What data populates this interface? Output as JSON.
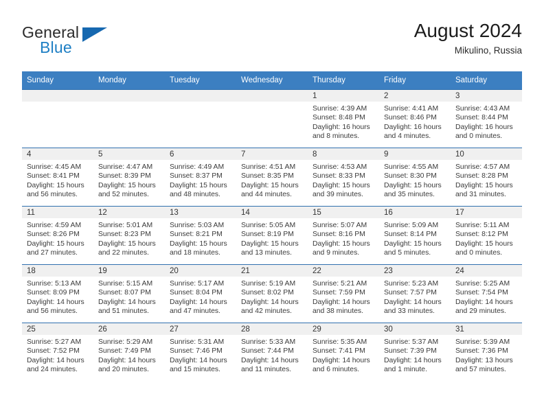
{
  "brand": {
    "line1": "General",
    "line2": "Blue",
    "triangle_icon": "triangle-logo-icon",
    "blue": "#1e7fc4"
  },
  "header": {
    "title": "August 2024",
    "subtitle": "Mikulino, Russia"
  },
  "calendar": {
    "header_bg": "#3C7FC1",
    "daynum_bg": "#f0f0f0",
    "weekdays": [
      "Sunday",
      "Monday",
      "Tuesday",
      "Wednesday",
      "Thursday",
      "Friday",
      "Saturday"
    ],
    "weeks": [
      [
        {
          "day": "",
          "sunrise": "",
          "sunset": "",
          "daylight1": "",
          "daylight2": ""
        },
        {
          "day": "",
          "sunrise": "",
          "sunset": "",
          "daylight1": "",
          "daylight2": ""
        },
        {
          "day": "",
          "sunrise": "",
          "sunset": "",
          "daylight1": "",
          "daylight2": ""
        },
        {
          "day": "",
          "sunrise": "",
          "sunset": "",
          "daylight1": "",
          "daylight2": ""
        },
        {
          "day": "1",
          "sunrise": "Sunrise: 4:39 AM",
          "sunset": "Sunset: 8:48 PM",
          "daylight1": "Daylight: 16 hours",
          "daylight2": "and 8 minutes."
        },
        {
          "day": "2",
          "sunrise": "Sunrise: 4:41 AM",
          "sunset": "Sunset: 8:46 PM",
          "daylight1": "Daylight: 16 hours",
          "daylight2": "and 4 minutes."
        },
        {
          "day": "3",
          "sunrise": "Sunrise: 4:43 AM",
          "sunset": "Sunset: 8:44 PM",
          "daylight1": "Daylight: 16 hours",
          "daylight2": "and 0 minutes."
        }
      ],
      [
        {
          "day": "4",
          "sunrise": "Sunrise: 4:45 AM",
          "sunset": "Sunset: 8:41 PM",
          "daylight1": "Daylight: 15 hours",
          "daylight2": "and 56 minutes."
        },
        {
          "day": "5",
          "sunrise": "Sunrise: 4:47 AM",
          "sunset": "Sunset: 8:39 PM",
          "daylight1": "Daylight: 15 hours",
          "daylight2": "and 52 minutes."
        },
        {
          "day": "6",
          "sunrise": "Sunrise: 4:49 AM",
          "sunset": "Sunset: 8:37 PM",
          "daylight1": "Daylight: 15 hours",
          "daylight2": "and 48 minutes."
        },
        {
          "day": "7",
          "sunrise": "Sunrise: 4:51 AM",
          "sunset": "Sunset: 8:35 PM",
          "daylight1": "Daylight: 15 hours",
          "daylight2": "and 44 minutes."
        },
        {
          "day": "8",
          "sunrise": "Sunrise: 4:53 AM",
          "sunset": "Sunset: 8:33 PM",
          "daylight1": "Daylight: 15 hours",
          "daylight2": "and 39 minutes."
        },
        {
          "day": "9",
          "sunrise": "Sunrise: 4:55 AM",
          "sunset": "Sunset: 8:30 PM",
          "daylight1": "Daylight: 15 hours",
          "daylight2": "and 35 minutes."
        },
        {
          "day": "10",
          "sunrise": "Sunrise: 4:57 AM",
          "sunset": "Sunset: 8:28 PM",
          "daylight1": "Daylight: 15 hours",
          "daylight2": "and 31 minutes."
        }
      ],
      [
        {
          "day": "11",
          "sunrise": "Sunrise: 4:59 AM",
          "sunset": "Sunset: 8:26 PM",
          "daylight1": "Daylight: 15 hours",
          "daylight2": "and 27 minutes."
        },
        {
          "day": "12",
          "sunrise": "Sunrise: 5:01 AM",
          "sunset": "Sunset: 8:23 PM",
          "daylight1": "Daylight: 15 hours",
          "daylight2": "and 22 minutes."
        },
        {
          "day": "13",
          "sunrise": "Sunrise: 5:03 AM",
          "sunset": "Sunset: 8:21 PM",
          "daylight1": "Daylight: 15 hours",
          "daylight2": "and 18 minutes."
        },
        {
          "day": "14",
          "sunrise": "Sunrise: 5:05 AM",
          "sunset": "Sunset: 8:19 PM",
          "daylight1": "Daylight: 15 hours",
          "daylight2": "and 13 minutes."
        },
        {
          "day": "15",
          "sunrise": "Sunrise: 5:07 AM",
          "sunset": "Sunset: 8:16 PM",
          "daylight1": "Daylight: 15 hours",
          "daylight2": "and 9 minutes."
        },
        {
          "day": "16",
          "sunrise": "Sunrise: 5:09 AM",
          "sunset": "Sunset: 8:14 PM",
          "daylight1": "Daylight: 15 hours",
          "daylight2": "and 5 minutes."
        },
        {
          "day": "17",
          "sunrise": "Sunrise: 5:11 AM",
          "sunset": "Sunset: 8:12 PM",
          "daylight1": "Daylight: 15 hours",
          "daylight2": "and 0 minutes."
        }
      ],
      [
        {
          "day": "18",
          "sunrise": "Sunrise: 5:13 AM",
          "sunset": "Sunset: 8:09 PM",
          "daylight1": "Daylight: 14 hours",
          "daylight2": "and 56 minutes."
        },
        {
          "day": "19",
          "sunrise": "Sunrise: 5:15 AM",
          "sunset": "Sunset: 8:07 PM",
          "daylight1": "Daylight: 14 hours",
          "daylight2": "and 51 minutes."
        },
        {
          "day": "20",
          "sunrise": "Sunrise: 5:17 AM",
          "sunset": "Sunset: 8:04 PM",
          "daylight1": "Daylight: 14 hours",
          "daylight2": "and 47 minutes."
        },
        {
          "day": "21",
          "sunrise": "Sunrise: 5:19 AM",
          "sunset": "Sunset: 8:02 PM",
          "daylight1": "Daylight: 14 hours",
          "daylight2": "and 42 minutes."
        },
        {
          "day": "22",
          "sunrise": "Sunrise: 5:21 AM",
          "sunset": "Sunset: 7:59 PM",
          "daylight1": "Daylight: 14 hours",
          "daylight2": "and 38 minutes."
        },
        {
          "day": "23",
          "sunrise": "Sunrise: 5:23 AM",
          "sunset": "Sunset: 7:57 PM",
          "daylight1": "Daylight: 14 hours",
          "daylight2": "and 33 minutes."
        },
        {
          "day": "24",
          "sunrise": "Sunrise: 5:25 AM",
          "sunset": "Sunset: 7:54 PM",
          "daylight1": "Daylight: 14 hours",
          "daylight2": "and 29 minutes."
        }
      ],
      [
        {
          "day": "25",
          "sunrise": "Sunrise: 5:27 AM",
          "sunset": "Sunset: 7:52 PM",
          "daylight1": "Daylight: 14 hours",
          "daylight2": "and 24 minutes."
        },
        {
          "day": "26",
          "sunrise": "Sunrise: 5:29 AM",
          "sunset": "Sunset: 7:49 PM",
          "daylight1": "Daylight: 14 hours",
          "daylight2": "and 20 minutes."
        },
        {
          "day": "27",
          "sunrise": "Sunrise: 5:31 AM",
          "sunset": "Sunset: 7:46 PM",
          "daylight1": "Daylight: 14 hours",
          "daylight2": "and 15 minutes."
        },
        {
          "day": "28",
          "sunrise": "Sunrise: 5:33 AM",
          "sunset": "Sunset: 7:44 PM",
          "daylight1": "Daylight: 14 hours",
          "daylight2": "and 11 minutes."
        },
        {
          "day": "29",
          "sunrise": "Sunrise: 5:35 AM",
          "sunset": "Sunset: 7:41 PM",
          "daylight1": "Daylight: 14 hours",
          "daylight2": "and 6 minutes."
        },
        {
          "day": "30",
          "sunrise": "Sunrise: 5:37 AM",
          "sunset": "Sunset: 7:39 PM",
          "daylight1": "Daylight: 14 hours",
          "daylight2": "and 1 minute."
        },
        {
          "day": "31",
          "sunrise": "Sunrise: 5:39 AM",
          "sunset": "Sunset: 7:36 PM",
          "daylight1": "Daylight: 13 hours",
          "daylight2": "and 57 minutes."
        }
      ]
    ]
  }
}
